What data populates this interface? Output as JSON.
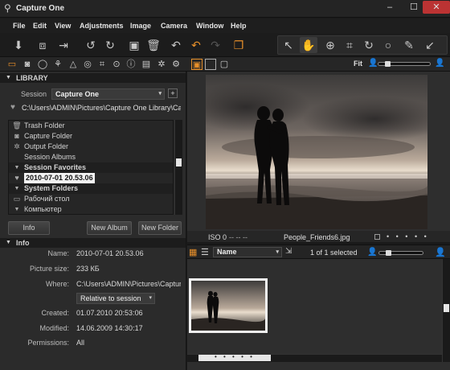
{
  "window": {
    "title": "Capture One",
    "minimize": "–",
    "maximize": "☐",
    "close": "✕"
  },
  "menu": [
    "File",
    "Edit",
    "View",
    "Adjustments",
    "Image",
    "Camera",
    "Window",
    "Help"
  ],
  "toolbar": {
    "icons": [
      "import-icon",
      "capture-icon",
      "export-icon",
      "rotate-left-icon",
      "rotate-right-icon",
      "new-folder-icon",
      "delete-icon",
      "undo-icon",
      "undo-all-icon",
      "redo-icon",
      "stack-icon"
    ],
    "cursor_tools": [
      "pointer-icon",
      "hand-icon",
      "zoom-icon",
      "crop-icon",
      "rotate-tool-icon",
      "circle-icon",
      "picker-icon",
      "annotate-icon"
    ]
  },
  "tabs": [
    "folder-tab",
    "camera-tab",
    "capture-pilot-tab",
    "color-tab",
    "exposure-tab",
    "crop-tab",
    "focus-tab",
    "metadata-tab",
    "details-tab",
    "settings-tab",
    "output-tab"
  ],
  "view_modes": [
    "viewer-only",
    "viewer-browser",
    "browser-only"
  ],
  "zoom": {
    "label": "Fit"
  },
  "library": {
    "header": "LIBRARY",
    "session_label": "Session",
    "session_value": "Capture One",
    "add": "+",
    "path": "C:\\Users\\ADMIN\\Pictures\\Capture One Library\\Cap",
    "tree": [
      {
        "label": "Trash Folder",
        "icon": "trash-icon",
        "type": "item"
      },
      {
        "label": "Capture Folder",
        "icon": "camera-folder-icon",
        "type": "item"
      },
      {
        "label": "Output Folder",
        "icon": "gear-folder-icon",
        "type": "item"
      },
      {
        "label": "Session Albums",
        "icon": "",
        "type": "item"
      },
      {
        "label": "Session Favorites",
        "icon": "",
        "type": "group"
      },
      {
        "label": "2010-07-01 20.53.06",
        "icon": "heart-icon",
        "type": "selected"
      },
      {
        "label": "System Folders",
        "icon": "",
        "type": "group"
      },
      {
        "label": "Рабочий стол",
        "icon": "desktop-icon",
        "type": "item"
      },
      {
        "label": "Компьютер",
        "icon": "computer-icon",
        "type": "item"
      }
    ],
    "buttons": {
      "info": "Info",
      "new_album": "New Album",
      "new_folder": "New Folder"
    }
  },
  "info": {
    "header": "Info",
    "rows": [
      {
        "key": "Name:",
        "value": "2010-07-01 20.53.06"
      },
      {
        "key": "Picture size:",
        "value": "233 КБ"
      },
      {
        "key": "Where:",
        "value": "C:\\Users\\ADMIN\\Pictures\\Captur"
      },
      {
        "key": "Created:",
        "value": "01.07.2010 20:53:06"
      },
      {
        "key": "Modified:",
        "value": "14.06.2009 14:30:17"
      },
      {
        "key": "Permissions:",
        "value": "All"
      }
    ],
    "relative": "Relative to session"
  },
  "viewer": {
    "iso": "ISO 0",
    "dashes": "--  --  --",
    "filename": "People_Friends6.jpg",
    "rating": "• • • • •"
  },
  "browser": {
    "sort_label": "Name",
    "count": "1 of 1 selected",
    "thumb_rating": "• • • • •"
  }
}
